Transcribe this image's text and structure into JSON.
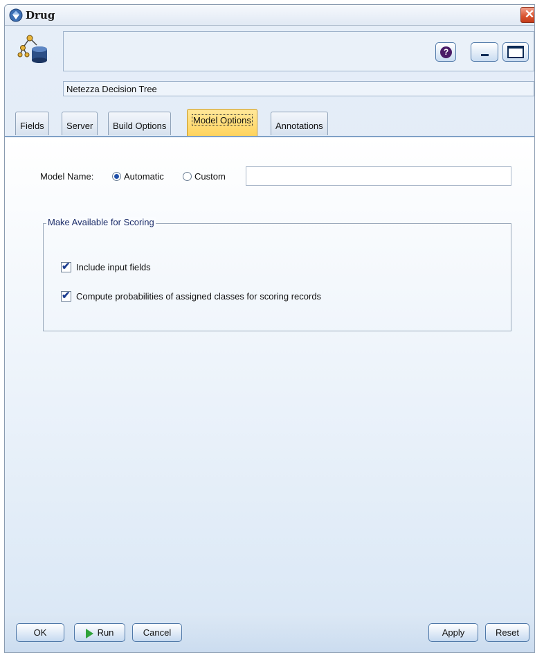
{
  "window": {
    "title": "Drug",
    "close_glyph": "✕"
  },
  "header": {
    "node_name": "",
    "subtitle": "Netezza Decision Tree",
    "help_glyph": "?"
  },
  "tabs": [
    {
      "label": "Fields"
    },
    {
      "label": "Server"
    },
    {
      "label": "Build Options"
    },
    {
      "label": "Model Options",
      "active": true
    },
    {
      "label": "Annotations"
    }
  ],
  "model_options": {
    "model_name_label": "Model Name:",
    "radio_automatic": "Automatic",
    "radio_custom": "Custom",
    "selected": "Automatic",
    "custom_value": "",
    "scoring_group_title": "Make Available for Scoring",
    "include_input_fields": {
      "label": "Include input fields",
      "checked": true
    },
    "compute_probabilities": {
      "label": "Compute probabilities of assigned classes for scoring records",
      "checked": true
    }
  },
  "footer": {
    "ok": "OK",
    "run": "Run",
    "cancel": "Cancel",
    "apply": "Apply",
    "reset": "Reset"
  },
  "icons": [
    "app-diamond-icon",
    "decision-tree-db-icon",
    "help-icon",
    "minimize-icon",
    "maximize-icon",
    "close-icon",
    "run-play-icon"
  ],
  "colors": {
    "active_tab": "#ffd35c",
    "close": "#d9532f",
    "run_arrow": "#2fa33a"
  }
}
